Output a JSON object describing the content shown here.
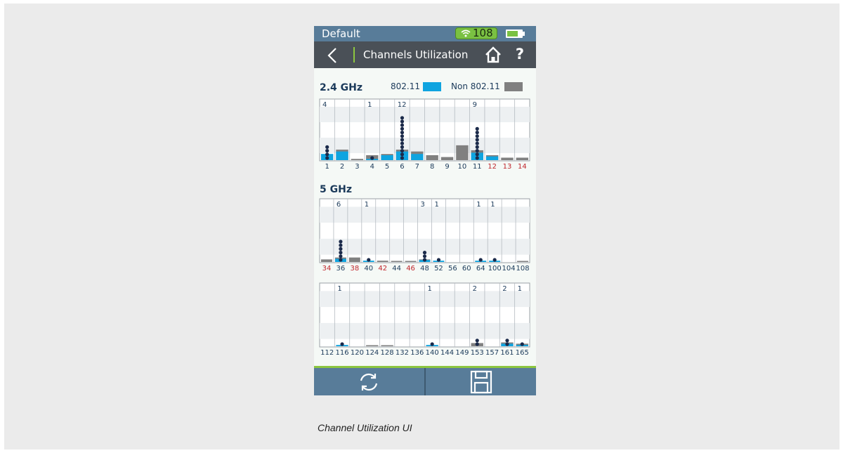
{
  "status_bar": {
    "profile": "Default",
    "wifi_count": "108"
  },
  "header": {
    "title": "Channels Utilization"
  },
  "legend": {
    "wifi_label": "802.11",
    "non_wifi_label": "Non 802.11"
  },
  "colors": {
    "wifi": "#0fa4e0",
    "non_wifi": "#808080",
    "device": "#1b2a4a",
    "restricted_channel": "#c0272d",
    "normal_channel": "#1b3a5a"
  },
  "bands": [
    {
      "title": "2.4 GHz",
      "channels": [
        {
          "ch": "1",
          "wifi": 10,
          "non": 0,
          "count": 4,
          "restricted": false
        },
        {
          "ch": "2",
          "wifi": 14,
          "non": 3,
          "count": 0,
          "restricted": false
        },
        {
          "ch": "3",
          "wifi": 0,
          "non": 2,
          "count": 0,
          "restricted": false
        },
        {
          "ch": "4",
          "wifi": 2,
          "non": 6,
          "count": 1,
          "restricted": false
        },
        {
          "ch": "5",
          "wifi": 8,
          "non": 2,
          "count": 0,
          "restricted": false
        },
        {
          "ch": "6",
          "wifi": 14,
          "non": 3,
          "count": 12,
          "restricted": false
        },
        {
          "ch": "7",
          "wifi": 10,
          "non": 4,
          "count": 0,
          "restricted": false
        },
        {
          "ch": "8",
          "wifi": 0,
          "non": 8,
          "count": 0,
          "restricted": false
        },
        {
          "ch": "9",
          "wifi": 0,
          "non": 5,
          "count": 0,
          "restricted": false
        },
        {
          "ch": "10",
          "wifi": 0,
          "non": 24,
          "count": 0,
          "restricted": false
        },
        {
          "ch": "11",
          "wifi": 12,
          "non": 4,
          "count": 9,
          "restricted": false
        },
        {
          "ch": "12",
          "wifi": 6,
          "non": 2,
          "count": 0,
          "restricted": true
        },
        {
          "ch": "13",
          "wifi": 0,
          "non": 4,
          "count": 0,
          "restricted": true
        },
        {
          "ch": "14",
          "wifi": 0,
          "non": 4,
          "count": 0,
          "restricted": true
        }
      ]
    },
    {
      "title": "5 GHz",
      "channels": [
        {
          "ch": "34",
          "wifi": 0,
          "non": 4,
          "count": 0,
          "restricted": true
        },
        {
          "ch": "36",
          "wifi": 5,
          "non": 2,
          "count": 6,
          "restricted": false
        },
        {
          "ch": "38",
          "wifi": 0,
          "non": 7,
          "count": 0,
          "restricted": true
        },
        {
          "ch": "40",
          "wifi": 2,
          "non": 0,
          "count": 1,
          "restricted": false
        },
        {
          "ch": "42",
          "wifi": 0,
          "non": 2,
          "count": 0,
          "restricted": true
        },
        {
          "ch": "44",
          "wifi": 0,
          "non": 1,
          "count": 0,
          "restricted": false
        },
        {
          "ch": "46",
          "wifi": 0,
          "non": 1,
          "count": 0,
          "restricted": true
        },
        {
          "ch": "48",
          "wifi": 3,
          "non": 1,
          "count": 3,
          "restricted": false
        },
        {
          "ch": "52",
          "wifi": 2,
          "non": 0,
          "count": 1,
          "restricted": false
        },
        {
          "ch": "56",
          "wifi": 0,
          "non": 0,
          "count": 0,
          "restricted": false
        },
        {
          "ch": "60",
          "wifi": 0,
          "non": 0,
          "count": 0,
          "restricted": false
        },
        {
          "ch": "64",
          "wifi": 2,
          "non": 0,
          "count": 1,
          "restricted": false
        },
        {
          "ch": "100",
          "wifi": 2,
          "non": 0,
          "count": 1,
          "restricted": false
        },
        {
          "ch": "104",
          "wifi": 0,
          "non": 0,
          "count": 0,
          "restricted": false
        },
        {
          "ch": "108",
          "wifi": 0,
          "non": 1,
          "count": 0,
          "restricted": false
        }
      ]
    },
    {
      "title": "",
      "channels": [
        {
          "ch": "112",
          "wifi": 0,
          "non": 0,
          "count": 0,
          "restricted": false
        },
        {
          "ch": "116",
          "wifi": 2,
          "non": 0,
          "count": 1,
          "restricted": false
        },
        {
          "ch": "120",
          "wifi": 0,
          "non": 0,
          "count": 0,
          "restricted": false
        },
        {
          "ch": "124",
          "wifi": 0,
          "non": 1,
          "count": 0,
          "restricted": false
        },
        {
          "ch": "128",
          "wifi": 0,
          "non": 1,
          "count": 0,
          "restricted": false
        },
        {
          "ch": "132",
          "wifi": 0,
          "non": 0,
          "count": 0,
          "restricted": false
        },
        {
          "ch": "136",
          "wifi": 0,
          "non": 0,
          "count": 0,
          "restricted": false
        },
        {
          "ch": "140",
          "wifi": 2,
          "non": 0,
          "count": 1,
          "restricted": false
        },
        {
          "ch": "144",
          "wifi": 0,
          "non": 0,
          "count": 0,
          "restricted": false
        },
        {
          "ch": "149",
          "wifi": 0,
          "non": 0,
          "count": 0,
          "restricted": false
        },
        {
          "ch": "153",
          "wifi": 0,
          "non": 5,
          "count": 2,
          "restricted": false
        },
        {
          "ch": "157",
          "wifi": 0,
          "non": 0,
          "count": 0,
          "restricted": false
        },
        {
          "ch": "161",
          "wifi": 4,
          "non": 2,
          "count": 2,
          "restricted": false
        },
        {
          "ch": "165",
          "wifi": 2,
          "non": 2,
          "count": 1,
          "restricted": false
        }
      ]
    }
  ],
  "caption": "Channel Utilization UI"
}
